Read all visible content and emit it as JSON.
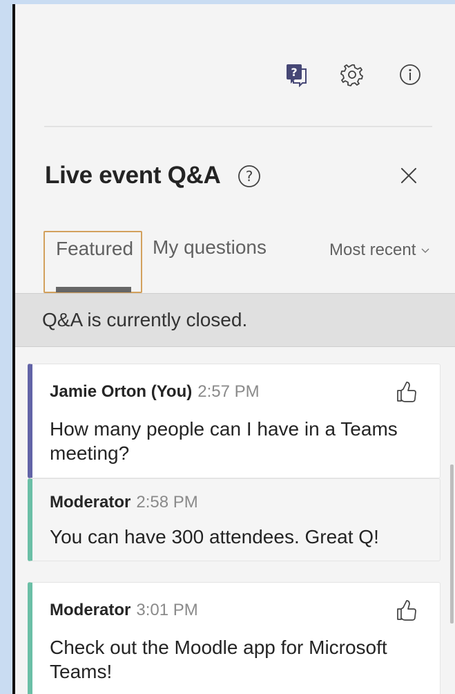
{
  "header": {
    "title": "Live event Q&A",
    "icons": [
      "qa-icon",
      "gear-icon",
      "info-icon",
      "help-icon",
      "close-icon"
    ]
  },
  "tabs": {
    "featured": "Featured",
    "my_questions": "My questions",
    "sort_label": "Most recent"
  },
  "banner": {
    "text": "Q&A is currently closed."
  },
  "messages": [
    {
      "author": "Jamie Orton (You)",
      "time": "2:57 PM",
      "text": "How many people can I have in a Teams meeting?"
    },
    {
      "author": "Moderator",
      "time": "2:58 PM",
      "text": "You can have 300 attendees. Great Q!"
    },
    {
      "author": "Moderator",
      "time": "3:01 PM",
      "text": "Check out the Moodle app for Microsoft Teams!"
    }
  ],
  "colors": {
    "accent": "#6264a7",
    "moderator_bar": "#6bbfa6",
    "focus_outline": "#d2a05c",
    "panel_bg": "#f4f4f4"
  }
}
